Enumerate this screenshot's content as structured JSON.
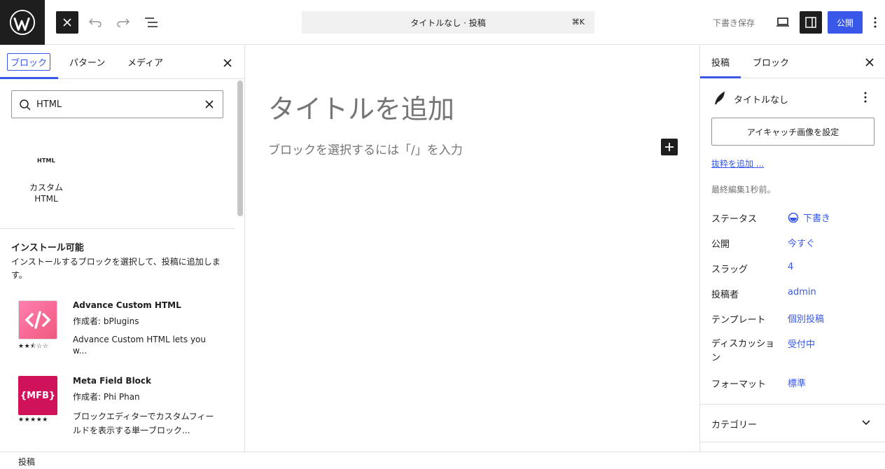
{
  "topbar": {
    "document_title": "タイトルなし · 投稿",
    "shortcut": "⌘K",
    "save_draft": "下書き保存",
    "publish": "公開"
  },
  "inserter": {
    "tabs": [
      "ブロック",
      "パターン",
      "メディア"
    ],
    "search_value": "HTML",
    "result_icon_text": "HTML",
    "result_label_line1": "カスタム",
    "result_label_line2": "HTML",
    "install_title": "インストール可能",
    "install_desc": "インストールするブロックを選択して、投稿に追加します。",
    "plugins": [
      {
        "name": "Advance Custom HTML",
        "author": "作成者: bPlugins",
        "desc": "Advance Custom HTML lets you w...",
        "rating": "★★⯪☆☆",
        "icon_color": "#f9598b",
        "icon_text": "</>"
      },
      {
        "name": "Meta Field Block",
        "author": "作成者: Phi Phan",
        "desc": "ブロックエディターでカスタムフィールドを表示する単一ブロック...",
        "rating": "★★★★★",
        "icon_color": "#d0125b",
        "icon_text": "{MFB}"
      }
    ]
  },
  "canvas": {
    "title_placeholder": "タイトルを追加",
    "block_placeholder": "ブロックを選択するには「/」を入力"
  },
  "settings": {
    "tabs": [
      "投稿",
      "ブロック"
    ],
    "post_title": "タイトルなし",
    "featured_image_button": "アイキャッチ画像を設定",
    "excerpt_link": "抜粋を追加 ...",
    "last_edited": "最終編集1秒前。",
    "rows": [
      {
        "label": "ステータス",
        "value": "下書き"
      },
      {
        "label": "公開",
        "value": "今すぐ"
      },
      {
        "label": "スラッグ",
        "value": "4"
      },
      {
        "label": "投稿者",
        "value": "admin"
      },
      {
        "label": "テンプレート",
        "value": "個別投稿"
      },
      {
        "label": "ディスカッション",
        "value": "受付中"
      },
      {
        "label": "フォーマット",
        "value": "標準"
      }
    ],
    "categories_label": "カテゴリー"
  },
  "footer": {
    "breadcrumb": "投稿"
  },
  "colors": {
    "accent": "#3858e9",
    "dark": "#1e1e1e"
  }
}
